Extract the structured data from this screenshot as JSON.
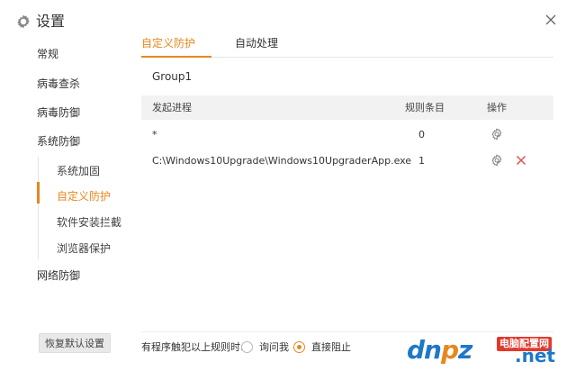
{
  "header": {
    "title": "设置",
    "icon": "gear-icon",
    "close_icon": "close-icon"
  },
  "sidebar": {
    "items": [
      {
        "label": "常规"
      },
      {
        "label": "病毒查杀"
      },
      {
        "label": "病毒防御"
      },
      {
        "label": "系统防御"
      }
    ],
    "sub_items": [
      {
        "label": "系统加固",
        "active": false
      },
      {
        "label": "自定义防护",
        "active": true
      },
      {
        "label": "软件安装拦截",
        "active": false
      },
      {
        "label": "浏览器保护",
        "active": false
      }
    ],
    "network": {
      "label": "网络防御"
    },
    "restore_button": "恢复默认设置"
  },
  "tabs": [
    {
      "label": "自定义防护",
      "active": true
    },
    {
      "label": "自动处理",
      "active": false
    }
  ],
  "group": {
    "label": "Group1"
  },
  "table": {
    "columns": [
      "发起进程",
      "规则条目",
      "操作"
    ],
    "rows": [
      {
        "process": "*",
        "count": "0",
        "actions": [
          "gear-icon"
        ]
      },
      {
        "process": "C:\\Windows10Upgrade\\Windows10UpgraderApp.exe",
        "count": "1",
        "actions": [
          "gear-icon",
          "delete-icon"
        ]
      }
    ]
  },
  "footer": {
    "label": "有程序触犯以上规则时:",
    "options": [
      {
        "label": "询问我",
        "checked": false
      },
      {
        "label": "直接阻止",
        "checked": true
      }
    ]
  },
  "watermark": {
    "text_a": "dn",
    "text_o": "p",
    "text_b": "z",
    "badge": "电脑配置网",
    "net": ".net"
  },
  "colors": {
    "accent": "#e8871e",
    "delete": "#d9534f",
    "header_bg": "#f2f2f2"
  }
}
